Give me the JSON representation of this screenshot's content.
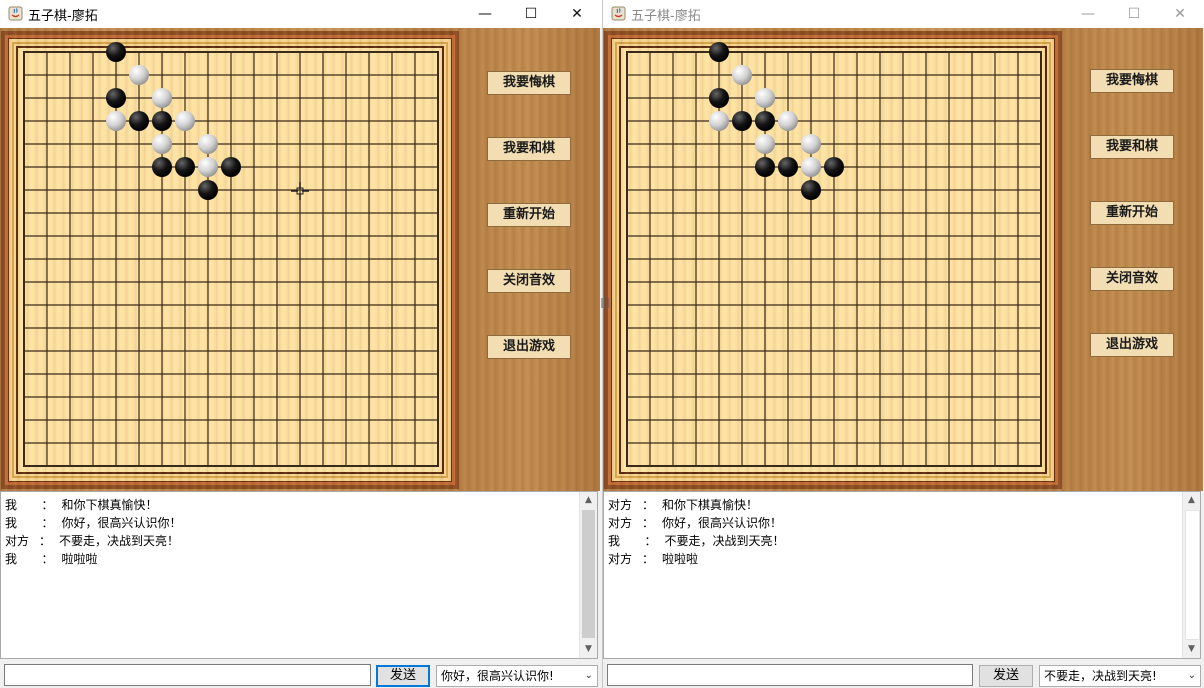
{
  "colors": {
    "black_stone": "#111111",
    "white_stone": "#d6d6d6",
    "grid": "#3a2a1a",
    "board": "#ffe3a3"
  },
  "board_size": 19,
  "windows": [
    {
      "id": "left",
      "title": "五子棋-廖拓",
      "active": true,
      "controls": {
        "minimize": "—",
        "maximize": "☐",
        "close": "✕"
      },
      "buttons": [
        "我要悔棋",
        "我要和棋",
        "重新开始",
        "关闭音效",
        "退出游戏"
      ],
      "stones": [
        {
          "col": 4,
          "row": 0,
          "color": "black"
        },
        {
          "col": 5,
          "row": 1,
          "color": "white"
        },
        {
          "col": 4,
          "row": 2,
          "color": "black"
        },
        {
          "col": 6,
          "row": 2,
          "color": "white"
        },
        {
          "col": 4,
          "row": 3,
          "color": "white"
        },
        {
          "col": 5,
          "row": 3,
          "color": "black"
        },
        {
          "col": 6,
          "row": 3,
          "color": "black"
        },
        {
          "col": 7,
          "row": 3,
          "color": "white"
        },
        {
          "col": 6,
          "row": 4,
          "color": "white"
        },
        {
          "col": 8,
          "row": 4,
          "color": "white"
        },
        {
          "col": 6,
          "row": 5,
          "color": "black"
        },
        {
          "col": 7,
          "row": 5,
          "color": "black"
        },
        {
          "col": 8,
          "row": 5,
          "color": "white"
        },
        {
          "col": 9,
          "row": 5,
          "color": "black"
        },
        {
          "col": 8,
          "row": 6,
          "color": "black"
        }
      ],
      "chat": [
        {
          "who": "我  ",
          "sep": "：",
          "text": "和你下棋真愉快！"
        },
        {
          "who": "我  ",
          "sep": "：",
          "text": "你好，很高兴认识你！"
        },
        {
          "who": "对方",
          "sep": "：",
          "text": "不要走，决战到天亮！"
        },
        {
          "who": "我  ",
          "sep": "：",
          "text": "啦啦啦"
        }
      ],
      "send_label": "发送",
      "message_input": "",
      "quick_phrase": "你好，很高兴认识你!"
    },
    {
      "id": "right",
      "title": "五子棋-廖拓",
      "active": false,
      "controls": {
        "minimize": "—",
        "maximize": "☐",
        "close": "✕"
      },
      "buttons": [
        "我要悔棋",
        "我要和棋",
        "重新开始",
        "关闭音效",
        "退出游戏"
      ],
      "stones": [
        {
          "col": 4,
          "row": 0,
          "color": "black"
        },
        {
          "col": 5,
          "row": 1,
          "color": "white"
        },
        {
          "col": 4,
          "row": 2,
          "color": "black"
        },
        {
          "col": 6,
          "row": 2,
          "color": "white"
        },
        {
          "col": 4,
          "row": 3,
          "color": "white"
        },
        {
          "col": 5,
          "row": 3,
          "color": "black"
        },
        {
          "col": 6,
          "row": 3,
          "color": "black"
        },
        {
          "col": 7,
          "row": 3,
          "color": "white"
        },
        {
          "col": 6,
          "row": 4,
          "color": "white"
        },
        {
          "col": 8,
          "row": 4,
          "color": "white"
        },
        {
          "col": 6,
          "row": 5,
          "color": "black"
        },
        {
          "col": 7,
          "row": 5,
          "color": "black"
        },
        {
          "col": 8,
          "row": 5,
          "color": "white"
        },
        {
          "col": 9,
          "row": 5,
          "color": "black"
        },
        {
          "col": 8,
          "row": 6,
          "color": "black"
        }
      ],
      "chat": [
        {
          "who": "对方",
          "sep": "：",
          "text": "和你下棋真愉快！"
        },
        {
          "who": "对方",
          "sep": "：",
          "text": "你好，很高兴认识你！"
        },
        {
          "who": "我  ",
          "sep": "：",
          "text": "不要走，决战到天亮！"
        },
        {
          "who": "对方",
          "sep": "：",
          "text": "啦啦啦"
        }
      ],
      "send_label": "发送",
      "message_input": "",
      "quick_phrase": "不要走，决战到天亮!"
    }
  ]
}
